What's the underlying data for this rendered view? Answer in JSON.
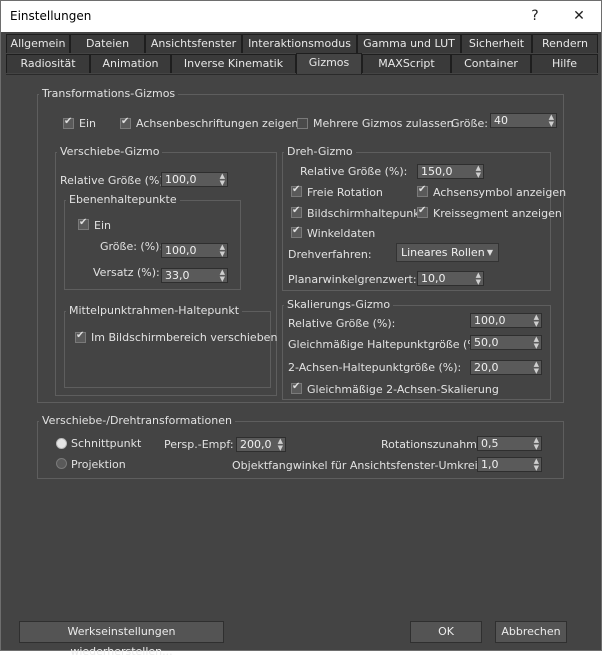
{
  "window": {
    "title": "Einstellungen",
    "help_label": "?",
    "close_label": "✕"
  },
  "tabs_row1": [
    "Allgemein",
    "Dateien",
    "Ansichtsfenster",
    "Interaktionsmodus",
    "Gamma und LUT",
    "Sicherheit",
    "Rendern"
  ],
  "tabs_row2": [
    "Radiosität",
    "Animation",
    "Inverse Kinematik",
    "Gizmos",
    "MAXScript",
    "Container",
    "Hilfe"
  ],
  "active_tab": "Gizmos",
  "transform": {
    "title": "Transformations-Gizmos",
    "on_label": "Ein",
    "on_checked": true,
    "axis_labels_label": "Achsenbeschriftungen zeigen",
    "axis_labels_checked": true,
    "multi_label": "Mehrere Gizmos zulassen",
    "multi_checked": false,
    "size_label": "Größe:",
    "size_value": "40"
  },
  "move": {
    "title": "Verschiebe-Gizmo",
    "rel_size_label": "Relative Größe (%):",
    "rel_size_value": "100,0",
    "plane": {
      "title": "Ebenenhaltepunkte",
      "on_label": "Ein",
      "on_checked": true,
      "size_label": "Größe: (%):",
      "size_value": "100,0",
      "offset_label": "Versatz (%):",
      "offset_value": "33,0"
    },
    "center": {
      "title": "Mittelpunktrahmen-Haltepunkt",
      "screen_label": "Im Bildschirmbereich verschieben",
      "screen_checked": true
    }
  },
  "rotate": {
    "title": "Dreh-Gizmo",
    "rel_size_label": "Relative Größe (%):",
    "rel_size_value": "150,0",
    "free_rotation_label": "Freie Rotation",
    "free_rotation_checked": true,
    "axis_symbol_label": "Achsensymbol anzeigen",
    "axis_symbol_checked": true,
    "screen_handle_label": "Bildschirmhaltepunkt",
    "screen_handle_checked": true,
    "circle_segment_label": "Kreissegment anzeigen",
    "circle_segment_checked": true,
    "angle_data_label": "Winkeldaten",
    "angle_data_checked": true,
    "method_label": "Drehverfahren:",
    "method_value": "Lineares Rollen",
    "plane_angle_label": "Planarwinkelgrenzwert:",
    "plane_angle_value": "10,0"
  },
  "scale": {
    "title": "Skalierungs-Gizmo",
    "rel_size_label": "Relative Größe (%):",
    "rel_size_value": "100,0",
    "uniform_handle_label": "Gleichmäßige Haltepunktgröße (%) :",
    "uniform_handle_value": "50,0",
    "two_axis_label": "2-Achsen-Haltepunktgröße (%):",
    "two_axis_value": "20,0",
    "uniform_two_axis_label": "Gleichmäßige 2-Achsen-Skalierung",
    "uniform_two_axis_checked": true
  },
  "move_rotate": {
    "title": "Verschiebe-/Drehtransformationen",
    "intersection_label": "Schnittpunkt",
    "intersection_selected": true,
    "projection_label": "Projektion",
    "projection_selected": false,
    "persp_label": "Persp.-Empf:",
    "persp_value": "200,0",
    "rot_inc_label": "Rotationszunahme:",
    "rot_inc_value": "0,5",
    "snap_label": "Objektfangwinkel für Ansichtsfenster-Umkreisung:",
    "snap_value": "1,0"
  },
  "buttons": {
    "reset": "Werkseinstellungen wiederherstellen...",
    "ok": "OK",
    "cancel": "Abbrechen"
  }
}
